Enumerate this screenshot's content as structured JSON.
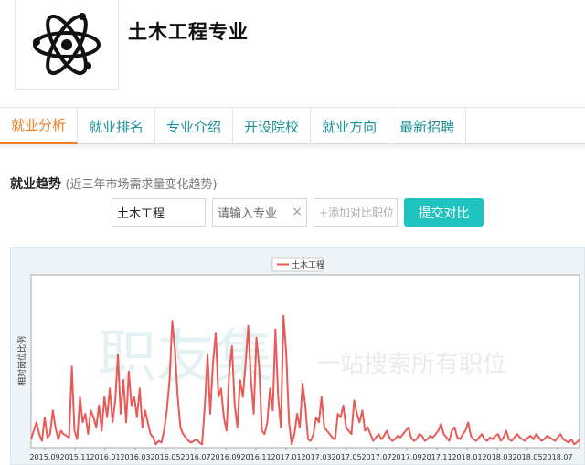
{
  "header": {
    "title": "土木工程专业",
    "logo_icon": "atom-icon"
  },
  "nav": {
    "tabs": [
      {
        "label": "就业分析",
        "active": true
      },
      {
        "label": "就业排名",
        "active": false
      },
      {
        "label": "专业介绍",
        "active": false
      },
      {
        "label": "开设院校",
        "active": false
      },
      {
        "label": "就业方向",
        "active": false
      },
      {
        "label": "最新招聘",
        "active": false
      }
    ],
    "active_color": "#f17f24",
    "tab_color": "#1a8f97"
  },
  "trend": {
    "title": "就业趋势",
    "subtitle": "(近三年市场需求量变化趋势)",
    "major_value": "土木工程",
    "input_placeholder": "请输入专业",
    "clear_symbol": "×",
    "add_placeholder": "+添加对比职位",
    "submit_label": "提交对比",
    "submit_color": "#1ec3c0"
  },
  "watermark": {
    "big": "职友集",
    "small": "一站搜索所有职位"
  },
  "chart_data": {
    "type": "line",
    "ylabel": "相对岗位比例",
    "legend_position": "top-center",
    "grid": false,
    "x_ticks": [
      "2015.09",
      "2015.11",
      "2016.01",
      "2016.03",
      "2016.05",
      "2016.07",
      "2016.09",
      "2016.11",
      "2017.01",
      "2017.03",
      "2017.05",
      "2017.07",
      "2017.09",
      "2017.11",
      "2018.01",
      "2018.03",
      "2018.05",
      "2018.07"
    ],
    "ylim": [
      0,
      100
    ],
    "series": [
      {
        "name": "土木工程",
        "color": "#e85a57",
        "x_range": [
          "2015.09",
          "2018.08"
        ],
        "values": [
          5,
          10,
          15,
          8,
          4,
          18,
          6,
          8,
          22,
          12,
          5,
          10,
          8,
          7,
          6,
          48,
          10,
          5,
          30,
          15,
          20,
          8,
          22,
          18,
          12,
          25,
          10,
          30,
          18,
          35,
          15,
          28,
          55,
          20,
          40,
          15,
          45,
          25,
          30,
          18,
          35,
          12,
          22,
          15,
          8,
          6,
          2,
          4,
          3,
          10,
          22,
          40,
          75,
          58,
          30,
          12,
          8,
          6,
          4,
          3,
          4,
          5,
          3,
          2,
          25,
          55,
          20,
          50,
          68,
          30,
          35,
          18,
          10,
          45,
          60,
          25,
          12,
          40,
          30,
          50,
          72,
          40,
          20,
          65,
          48,
          10,
          8,
          15,
          35,
          22,
          70,
          30,
          12,
          78,
          55,
          15,
          2,
          8,
          20,
          12,
          38,
          25,
          5,
          4,
          8,
          18,
          15,
          30,
          12,
          10,
          8,
          6,
          5,
          20,
          18,
          25,
          12,
          10,
          8,
          28,
          20,
          15,
          22,
          10,
          12,
          8,
          4,
          6,
          8,
          5,
          7,
          10,
          6,
          4,
          5,
          7,
          6,
          8,
          10,
          12,
          6,
          4,
          5,
          8,
          7,
          4,
          5,
          7,
          6,
          8,
          10,
          14,
          8,
          6,
          4,
          10,
          12,
          6,
          5,
          8,
          10,
          15,
          7,
          5,
          4,
          6,
          8,
          5,
          4,
          6,
          5,
          7,
          8,
          4,
          6,
          10,
          5,
          4,
          6,
          8,
          6,
          5,
          4,
          6,
          7,
          5,
          8,
          6,
          4,
          5,
          7,
          6,
          5,
          4,
          6,
          8,
          5,
          4,
          3,
          5,
          2,
          3,
          5
        ]
      }
    ]
  }
}
